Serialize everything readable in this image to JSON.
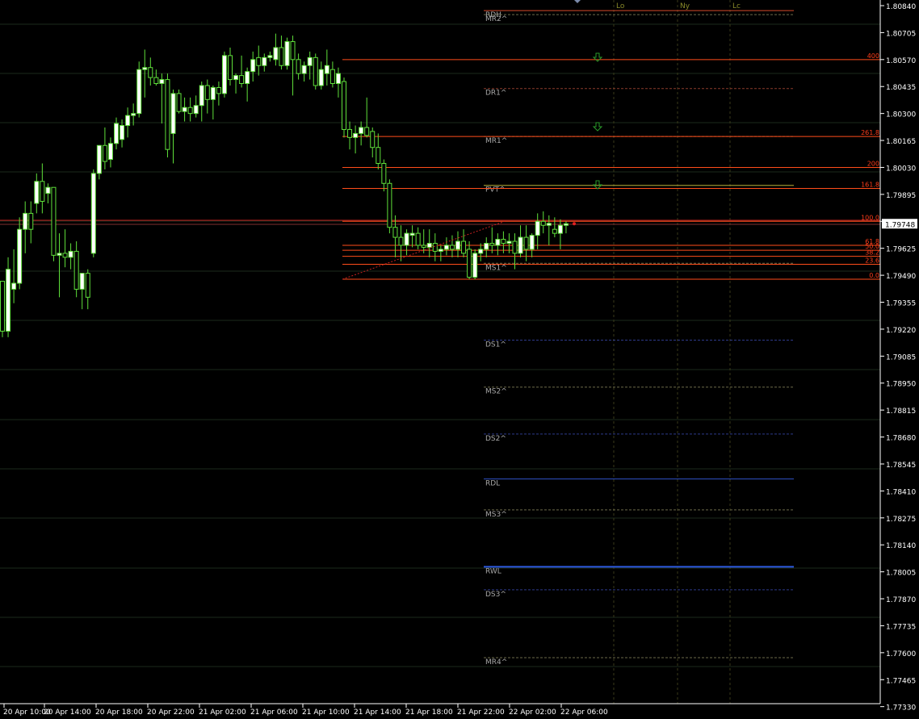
{
  "chart_data": {
    "type": "candlestick",
    "price_axis": {
      "min": 1.77365,
      "max": 1.8084,
      "ticks": [
        "1.80840",
        "1.80705",
        "1.80570",
        "1.80435",
        "1.80300",
        "1.80165",
        "1.80030",
        "1.79895",
        "1.79760",
        "1.79625",
        "1.79490",
        "1.79355",
        "1.79220",
        "1.79085",
        "1.78950",
        "1.78815",
        "1.78680",
        "1.78545",
        "1.78410",
        "1.78275",
        "1.78140",
        "1.78005",
        "1.77870",
        "1.77735",
        "1.77600",
        "1.77465",
        "1.77330"
      ]
    },
    "time_axis": {
      "labels": [
        "20 Apr 10:00",
        "20 Apr 14:00",
        "20 Apr 18:00",
        "20 Apr 22:00",
        "21 Apr 02:00",
        "21 Apr 06:00",
        "21 Apr 10:00",
        "21 Apr 14:00",
        "21 Apr 18:00",
        "21 Apr 22:00",
        "22 Apr 02:00",
        "22 Apr 06:00"
      ]
    },
    "current_price": "1.79748",
    "candles": [
      [
        1.7946,
        1.7946,
        1.7918,
        1.7921
      ],
      [
        1.7921,
        1.7958,
        1.7918,
        1.7952
      ],
      [
        1.7942,
        1.7962,
        1.7935,
        1.7945
      ],
      [
        1.7945,
        1.7978,
        1.7942,
        1.7972
      ],
      [
        1.7972,
        1.7986,
        1.796,
        1.798
      ],
      [
        1.798,
        1.7986,
        1.7965,
        1.7972
      ],
      [
        1.7985,
        1.8,
        1.798,
        1.7996
      ],
      [
        1.7996,
        1.8005,
        1.798,
        1.7986
      ],
      [
        1.799,
        1.7995,
        1.7985,
        1.7993
      ],
      [
        1.7993,
        1.7993,
        1.7956,
        1.7959
      ],
      [
        1.7959,
        1.797,
        1.7938,
        1.796
      ],
      [
        1.796,
        1.7972,
        1.7953,
        1.7958
      ],
      [
        1.7958,
        1.7965,
        1.7952,
        1.7961
      ],
      [
        1.7961,
        1.7966,
        1.7938,
        1.7942
      ],
      [
        1.7942,
        1.795,
        1.7932,
        1.795
      ],
      [
        1.795,
        1.7952,
        1.7932,
        1.7938
      ],
      [
        1.796,
        1.8002,
        1.7958,
        1.8
      ],
      [
        1.8,
        1.8014,
        1.7997,
        1.8014
      ],
      [
        1.8014,
        1.8023,
        1.8002,
        1.8006
      ],
      [
        1.8007,
        1.8018,
        1.8003,
        1.8015
      ],
      [
        1.8015,
        1.8028,
        1.8012,
        1.8025
      ],
      [
        1.8017,
        1.8027,
        1.8013,
        1.8024
      ],
      [
        1.8024,
        1.8033,
        1.8018,
        1.8029
      ],
      [
        1.8029,
        1.8035,
        1.8024,
        1.803
      ],
      [
        1.803,
        1.8056,
        1.8028,
        1.8052
      ],
      [
        1.8052,
        1.8062,
        1.8038,
        1.8053
      ],
      [
        1.8053,
        1.8058,
        1.8044,
        1.8048
      ],
      [
        1.8048,
        1.8052,
        1.8044,
        1.8045
      ],
      [
        1.8045,
        1.805,
        1.8025,
        1.8047
      ],
      [
        1.8047,
        1.805,
        1.8008,
        1.8012
      ],
      [
        1.802,
        1.8042,
        1.8005,
        1.804
      ],
      [
        1.804,
        1.8042,
        1.803,
        1.8031
      ],
      [
        1.8031,
        1.8038,
        1.8026,
        1.8033
      ],
      [
        1.8033,
        1.8038,
        1.8026,
        1.803
      ],
      [
        1.803,
        1.8039,
        1.8028,
        1.8034
      ],
      [
        1.8034,
        1.8046,
        1.8026,
        1.8044
      ],
      [
        1.8044,
        1.8047,
        1.803,
        1.8037
      ],
      [
        1.8037,
        1.8044,
        1.8027,
        1.8043
      ],
      [
        1.8043,
        1.8046,
        1.8034,
        1.804
      ],
      [
        1.804,
        1.8061,
        1.8038,
        1.8059
      ],
      [
        1.8059,
        1.8063,
        1.8044,
        1.8047
      ],
      [
        1.8047,
        1.805,
        1.804,
        1.8049
      ],
      [
        1.8049,
        1.8059,
        1.8043,
        1.8045
      ],
      [
        1.8045,
        1.8053,
        1.8036,
        1.8051
      ],
      [
        1.8051,
        1.8061,
        1.8046,
        1.8057
      ],
      [
        1.8058,
        1.8064,
        1.8049,
        1.8054
      ],
      [
        1.8054,
        1.806,
        1.8051,
        1.8058
      ],
      [
        1.8058,
        1.8061,
        1.8056,
        1.8059
      ],
      [
        1.8057,
        1.807,
        1.8054,
        1.8063
      ],
      [
        1.8063,
        1.8069,
        1.8052,
        1.8054
      ],
      [
        1.8054,
        1.8068,
        1.8052,
        1.8066
      ],
      [
        1.8066,
        1.8069,
        1.8039,
        1.8057
      ],
      [
        1.8057,
        1.806,
        1.8047,
        1.805
      ],
      [
        1.805,
        1.8056,
        1.8046,
        1.8054
      ],
      [
        1.8054,
        1.8061,
        1.8047,
        1.8058
      ],
      [
        1.8058,
        1.806,
        1.8042,
        1.8044
      ],
      [
        1.8044,
        1.8056,
        1.8042,
        1.8052
      ],
      [
        1.805,
        1.8062,
        1.8044,
        1.8054
      ],
      [
        1.8052,
        1.8056,
        1.8043,
        1.8045
      ],
      [
        1.8045,
        1.8053,
        1.8038,
        1.805
      ],
      [
        1.8046,
        1.8048,
        1.8018,
        1.8022
      ],
      [
        1.8022,
        1.8026,
        1.8012,
        1.8018
      ],
      [
        1.8018,
        1.8024,
        1.801,
        1.802
      ],
      [
        1.802,
        1.8026,
        1.8014,
        1.8023
      ],
      [
        1.8023,
        1.8038,
        1.8018,
        1.8019
      ],
      [
        1.8021,
        1.8023,
        1.8008,
        1.8013
      ],
      [
        1.8013,
        1.802,
        1.8002,
        1.8005
      ],
      [
        1.8005,
        1.8007,
        1.7991,
        1.7995
      ],
      [
        1.7995,
        1.7997,
        1.797,
        1.7973
      ],
      [
        1.7973,
        1.7979,
        1.7958,
        1.7968
      ],
      [
        1.7968,
        1.7974,
        1.7956,
        1.7964
      ],
      [
        1.7964,
        1.7972,
        1.7959,
        1.797
      ],
      [
        1.7969,
        1.7974,
        1.7963,
        1.797
      ],
      [
        1.797,
        1.7973,
        1.7962,
        1.7964
      ],
      [
        1.7964,
        1.7972,
        1.796,
        1.7963
      ],
      [
        1.7963,
        1.7972,
        1.7958,
        1.7965
      ],
      [
        1.7965,
        1.797,
        1.7956,
        1.7961
      ],
      [
        1.7961,
        1.7964,
        1.7956,
        1.7962
      ],
      [
        1.7962,
        1.7968,
        1.7959,
        1.7964
      ],
      [
        1.7964,
        1.7969,
        1.7958,
        1.7962
      ],
      [
        1.7962,
        1.7971,
        1.7958,
        1.7966
      ],
      [
        1.7966,
        1.7972,
        1.7958,
        1.796
      ],
      [
        1.7962,
        1.7966,
        1.7947,
        1.7948
      ],
      [
        1.7948,
        1.7962,
        1.7947,
        1.796
      ],
      [
        1.796,
        1.7965,
        1.7956,
        1.7962
      ],
      [
        1.7962,
        1.7968,
        1.7958,
        1.7965
      ],
      [
        1.7965,
        1.7973,
        1.796,
        1.7964
      ],
      [
        1.7964,
        1.797,
        1.7959,
        1.7967
      ],
      [
        1.7967,
        1.7971,
        1.796,
        1.7965
      ],
      [
        1.7965,
        1.797,
        1.796,
        1.7966
      ],
      [
        1.7966,
        1.797,
        1.7952,
        1.796
      ],
      [
        1.796,
        1.7974,
        1.7958,
        1.7968
      ],
      [
        1.7968,
        1.7974,
        1.7956,
        1.7962
      ],
      [
        1.7962,
        1.797,
        1.7958,
        1.7969
      ],
      [
        1.7969,
        1.798,
        1.7962,
        1.7976
      ],
      [
        1.7976,
        1.7981,
        1.797,
        1.7974
      ],
      [
        1.7974,
        1.7979,
        1.7964,
        1.7975
      ],
      [
        1.7972,
        1.7978,
        1.7968,
        1.797
      ],
      [
        1.797,
        1.7977,
        1.7962,
        1.7974
      ],
      [
        1.7974,
        1.7976,
        1.797,
        1.79748
      ]
    ],
    "levels": [
      {
        "label": "RDH",
        "price": 1.80815,
        "style": "solid",
        "color": "#d64a2a"
      },
      {
        "label": "MR2^",
        "price": 1.80795,
        "style": "dashed",
        "color": "#6d6a4a"
      },
      {
        "label": "DR1^",
        "price": 1.80425,
        "style": "dashed",
        "color": "#8a3a2a"
      },
      {
        "label": "MR1^",
        "price": 1.80185,
        "style": "dashed",
        "color": "#6d6a4a"
      },
      {
        "label": "PVT^",
        "price": 1.7994,
        "style": "solid",
        "color": "#b8b038"
      },
      {
        "label": "MS1^",
        "price": 1.7955,
        "style": "dashed",
        "color": "#6d6a4a"
      },
      {
        "label": "DS1^",
        "price": 1.79165,
        "style": "dashed",
        "color": "#2e3a8a"
      },
      {
        "label": "MS2^",
        "price": 1.7893,
        "style": "dashed",
        "color": "#6d6a4a"
      },
      {
        "label": "DS2^",
        "price": 1.78695,
        "style": "dashed",
        "color": "#2e3a8a"
      },
      {
        "label": "RDL",
        "price": 1.7847,
        "style": "solid",
        "color": "#2d4fc0"
      },
      {
        "label": "MS3^",
        "price": 1.78315,
        "style": "dashed",
        "color": "#6d6a4a"
      },
      {
        "label": "RWL",
        "price": 1.7803,
        "style": "solid",
        "color": "#2d5ae0"
      },
      {
        "label": "DS3^",
        "price": 1.77915,
        "style": "dashed",
        "color": "#2e3a8a"
      },
      {
        "label": "MR4^",
        "price": 1.77575,
        "style": "dashed",
        "color": "#6d6a4a"
      }
    ],
    "fibonacci": [
      {
        "label": "400",
        "price": 1.8057
      },
      {
        "label": "261.8",
        "price": 1.80185
      },
      {
        "label": "200",
        "price": 1.8003
      },
      {
        "label": "161.8",
        "price": 1.79925
      },
      {
        "label": "100.0",
        "price": 1.7976
      },
      {
        "label": "61.8",
        "price": 1.7964
      },
      {
        "label": "50.0",
        "price": 1.79615
      },
      {
        "label": "38.2",
        "price": 1.79585
      },
      {
        "label": "23.6",
        "price": 1.79545
      },
      {
        "label": "0.0",
        "price": 1.7947
      }
    ],
    "session_labels": [
      "Lo",
      "Ny",
      "Lc"
    ],
    "colors": {
      "bull_body": "#ffffff",
      "bear_body": "#000000",
      "candle_outline": "#5fe03a",
      "grid": "#262626",
      "level_orange": "#ff4d1a",
      "fib_line": "#ff4d1a",
      "fib_text": "#ff3d1a",
      "axis_text": "#ffffff",
      "current_bg": "#ffffff",
      "current_text": "#000000",
      "session": "#8a8a2a",
      "arrow": "#2a9a2a"
    }
  }
}
